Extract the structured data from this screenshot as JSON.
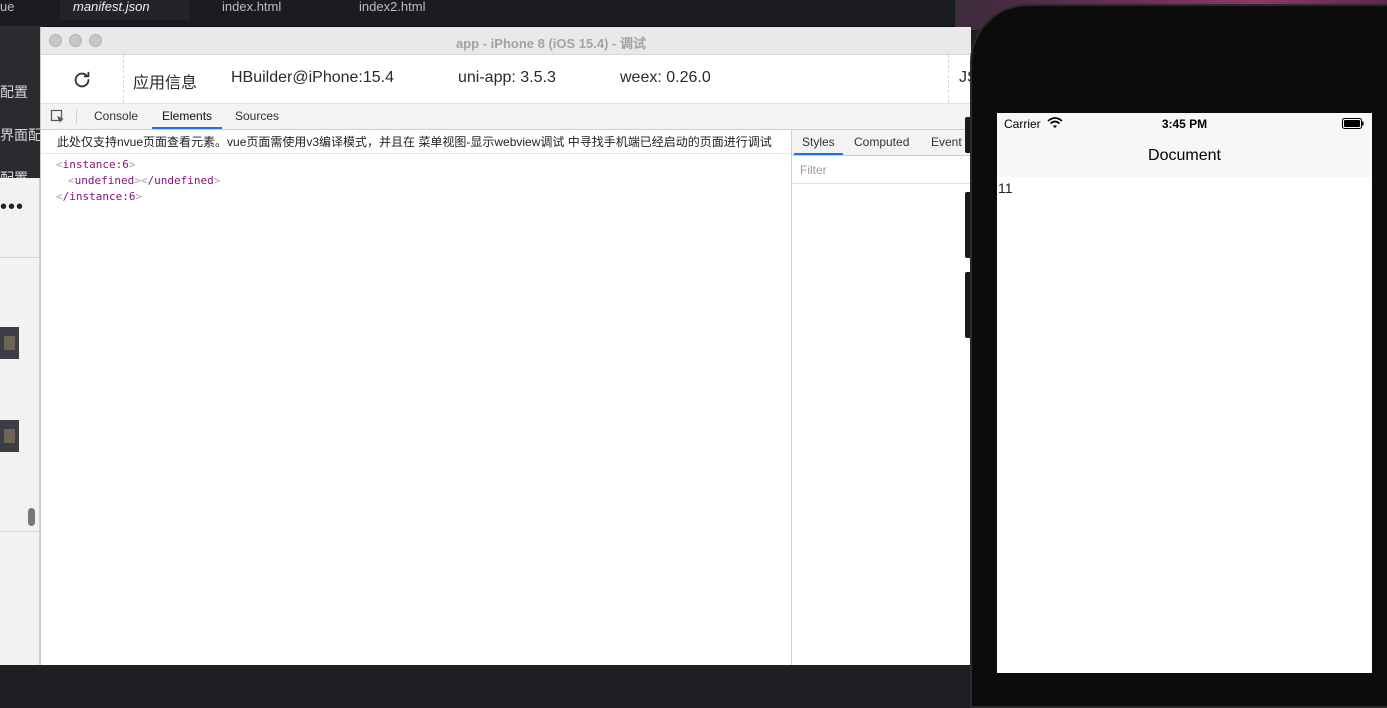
{
  "editor_tabs": [
    "ue",
    "manifest.json",
    "index.html",
    "index2.html"
  ],
  "left_panel": {
    "items": [
      "配置",
      "界面配置",
      "配置"
    ],
    "menu_dots": "•••"
  },
  "window": {
    "title": "app - iPhone 8 (iOS 15.4) - 调试"
  },
  "info_bar": {
    "app_info_label": "应用信息",
    "device": "HBuilder@iPhone:15.4",
    "uni_app_version": "uni-app: 3.5.3",
    "weex_version": "weex: 0.26.0",
    "truncated_label": "JS"
  },
  "devtools": {
    "tabs": [
      "Console",
      "Elements",
      "Sources"
    ],
    "active_tab": "Elements",
    "notice": "此处仅支持nvue页面查看元素。vue页面需使用v3编译模式，并且在 菜单视图-显示webview调试 中寻找手机端已经启动的页面进行调试",
    "dom": {
      "open_tag": "instance:6",
      "child_open": "undefined",
      "child_close": "/undefined",
      "close_tag": "/instance:6"
    },
    "styles_tabs": [
      "Styles",
      "Computed",
      "Event L"
    ],
    "filter_placeholder": "Filter"
  },
  "phone": {
    "carrier": "Carrier",
    "time": "3:45 PM",
    "nav_title": "Document",
    "content": "11"
  },
  "colors": {
    "accent": "#1a73e8",
    "tag": "#881280"
  }
}
